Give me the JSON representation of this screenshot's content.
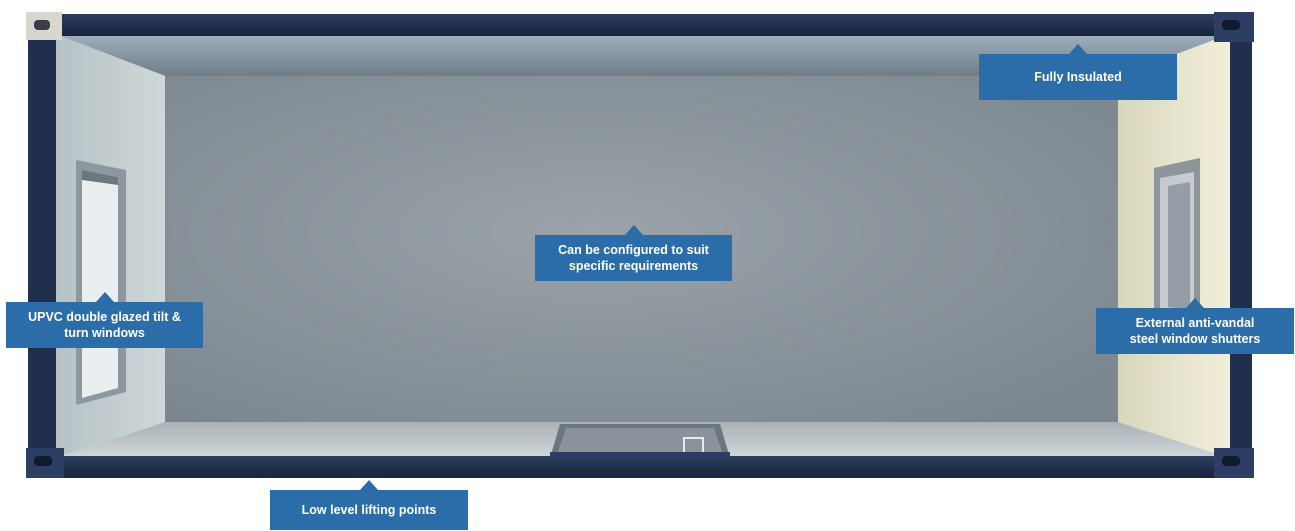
{
  "callouts": {
    "fully_insulated": {
      "lines": [
        "Fully Insulated"
      ]
    },
    "configured": {
      "lines": [
        "Can be configured to suit",
        "specific requirements"
      ]
    },
    "windows": {
      "lines": [
        "UPVC double glazed tilt &",
        "turn windows"
      ]
    },
    "shutters": {
      "lines": [
        "External anti-vandal",
        "steel window shutters"
      ]
    },
    "lifting": {
      "lines": [
        "Low level lifting points"
      ]
    }
  },
  "colors": {
    "callout_background": "#2a6da8",
    "container_frame": "#1f2f4d",
    "back_wall": "#8b959d",
    "floor": "#bfc5c8",
    "left_wall": "#c7d0d2",
    "right_wall": "#e8e6cf"
  }
}
